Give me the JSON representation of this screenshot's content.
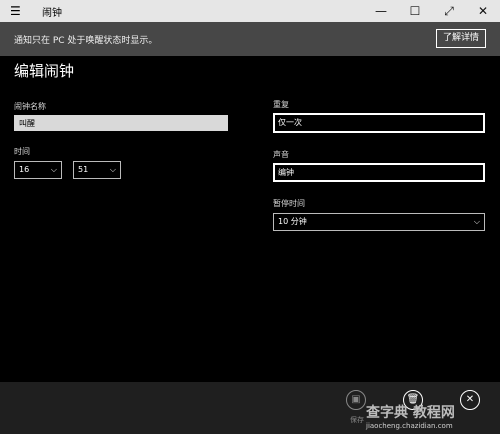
{
  "window": {
    "menu_icon": "hamburger-icon",
    "title": "闹钟",
    "controls": [
      "—",
      "☐",
      "⤢",
      "✕"
    ]
  },
  "notice": {
    "text": "通知只在 PC 处于唤醒状态时显示。",
    "button_label": "了解详情"
  },
  "page": {
    "title": "编辑闹钟"
  },
  "form": {
    "name_label": "闹钟名称",
    "name_value": "叫醒",
    "time_label": "时间",
    "hour_value": "16",
    "minute_value": "51",
    "repeat_label": "重复",
    "repeat_value": "仅一次",
    "sound_label": "声音",
    "sound_value": "编钟",
    "snooze_label": "暂停时间",
    "snooze_value": "10 分钟"
  },
  "bottom": {
    "save_label": "保存",
    "watermark_main": "查字典 教程网",
    "watermark_url": "jiaocheng.chazidian.com"
  }
}
